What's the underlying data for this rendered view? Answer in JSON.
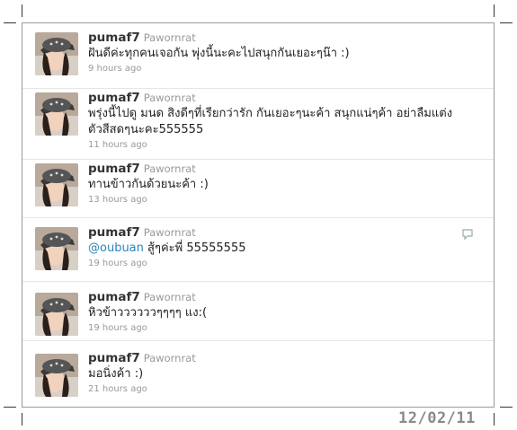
{
  "tweets": [
    {
      "screen_name": "pumaf7",
      "full_name": "Pawornrat",
      "text": "ฝันดีค่ะทุกคนเจอกัน พุ่งนี้นะคะไปสนุกกันเยอะๆน๊า :)",
      "time": "9 hours ago",
      "mention": "",
      "avatar_icon": "profile-photo"
    },
    {
      "screen_name": "pumaf7",
      "full_name": "Pawornrat",
      "text": "พรุ่งนี้ไปดู มนด สิงดีๆที่เรียกว่ารัก กันเยอะๆนะค้า สนุกแน่ๆค้า อย่าลืมแต่ง\nตัวสีสดๆนะคะ555555",
      "time": "11 hours ago",
      "mention": "",
      "avatar_icon": "profile-photo"
    },
    {
      "screen_name": "pumaf7",
      "full_name": "Pawornrat",
      "text": "ทานข้าวกันด้วยนะค้า :)",
      "time": "13 hours ago",
      "mention": "",
      "avatar_icon": "profile-photo"
    },
    {
      "screen_name": "pumaf7",
      "full_name": "Pawornrat",
      "mention": "@oubuan",
      "text": " สู้ๆค่ะพี่ 55555555",
      "time": "19 hours ago",
      "avatar_icon": "profile-photo",
      "reply_icon": "reply-icon"
    },
    {
      "screen_name": "pumaf7",
      "full_name": "Pawornrat",
      "text": "หิวข้าววววววๆๆๆๆ แง:(",
      "time": "19 hours ago",
      "mention": "",
      "avatar_icon": "profile-photo"
    },
    {
      "screen_name": "pumaf7",
      "full_name": "Pawornrat",
      "text": "มอนิ่งค้า :)",
      "time": "21 hours ago",
      "mention": "",
      "avatar_icon": "profile-photo"
    }
  ],
  "date_stamp": "12/02/11",
  "colors": {
    "mention": "#2a85b8",
    "name": "#333333",
    "meta": "#999999",
    "border": "#999999",
    "stamp": "#8a8a8a"
  }
}
